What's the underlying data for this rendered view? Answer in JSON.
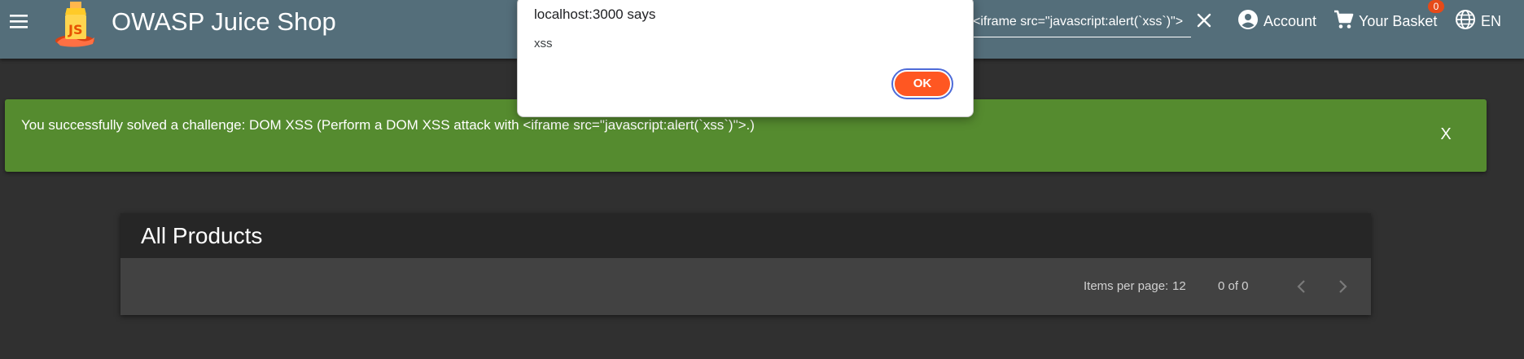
{
  "toolbar": {
    "app_title": "OWASP Juice Shop",
    "logo_icon": "juice-carton-logo-icon",
    "menu_icon": "hamburger-menu-icon",
    "search_value": "<iframe src=\"javascript:alert(`xss`)\">",
    "clear_icon": "close-icon",
    "account_label": "Account",
    "account_icon": "account-circle-icon",
    "basket_label": "Your Basket",
    "basket_icon": "shopping-cart-icon",
    "basket_count": "0",
    "language_label": "EN",
    "language_icon": "globe-icon",
    "colors": {
      "toolbar": "#546e7a",
      "badge": "#e64a19"
    }
  },
  "banner": {
    "message": "You successfully solved a challenge: DOM XSS (Perform a DOM XSS attack with <iframe src=\"javascript:alert(`xss`)\">.)",
    "close_label": "X",
    "color": "#558b2f"
  },
  "products": {
    "title": "All Products",
    "paginator": {
      "items_per_page_label": "Items per page:",
      "items_per_page_value": "12",
      "range_label": "0 of 0",
      "prev_icon": "chevron-left-icon",
      "next_icon": "chevron-right-icon"
    }
  },
  "dialog": {
    "title": "localhost:3000 says",
    "message": "xss",
    "ok_label": "OK",
    "ok_color": "#ff5722"
  }
}
